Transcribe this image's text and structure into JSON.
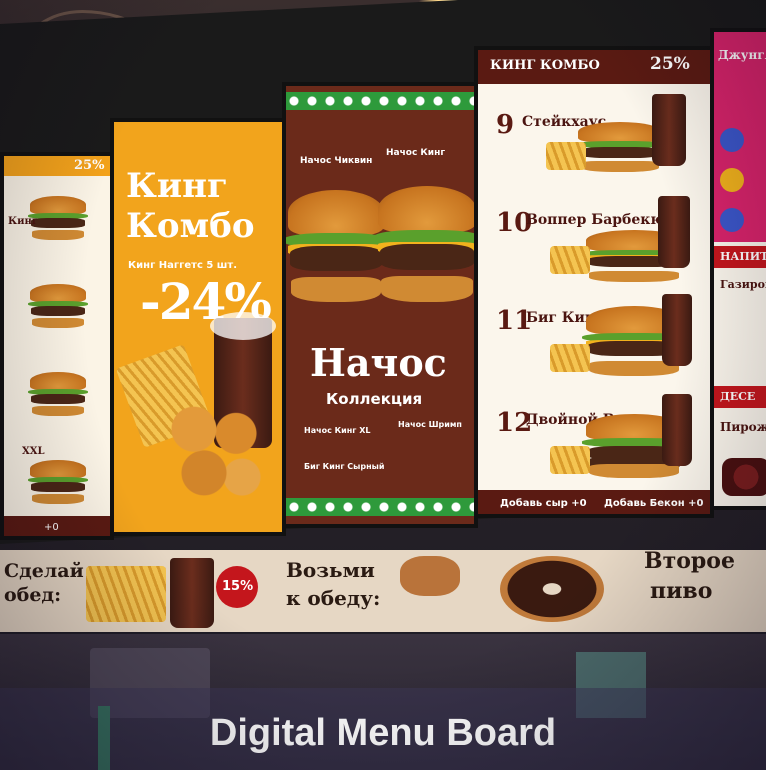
{
  "caption": "Digital Menu Board",
  "panels": {
    "left_partial": {
      "header": "25%",
      "labels": [
        "Кинг",
        "XXL",
        "+0"
      ]
    },
    "promo": {
      "title_line1": "Кинг",
      "title_line2": "Комбо",
      "subtitle": "Кинг Наггетс 5 шт.",
      "discount": "-24%"
    },
    "nachos": {
      "title": "Начос",
      "subtitle": "Коллекция",
      "items": [
        "Начос Чиквин",
        "Начос Кинг",
        "Начос Кинг XL",
        "Начос Шримп",
        "Биг Кинг Сырный"
      ]
    },
    "combo": {
      "header": "КИНГ КОМБО",
      "header_discount": "25%",
      "rows": [
        {
          "num": "9",
          "name": "Стейкхаус"
        },
        {
          "num": "10",
          "name": "Воппер Барбекю"
        },
        {
          "num": "11",
          "name": "Биг Кинг XXL"
        },
        {
          "num": "12",
          "name": "Двойной Воппер"
        }
      ],
      "footer_left": "Добавь сыр +0",
      "footer_right": "Добавь Бекон +0"
    },
    "right_partial": {
      "header": "Джунгли",
      "section": "НАПИТ",
      "drink": "Газиров",
      "dessert_header": "ДЕСЕ",
      "dessert": "Пирож"
    }
  },
  "counter_banners": {
    "left": {
      "line1": "Сделай",
      "line2": "обед:",
      "badge": "15%"
    },
    "center": {
      "line1": "Возьми",
      "line2": "к обеду:"
    },
    "right": {
      "line1": "Второе",
      "line2": "пиво"
    }
  }
}
